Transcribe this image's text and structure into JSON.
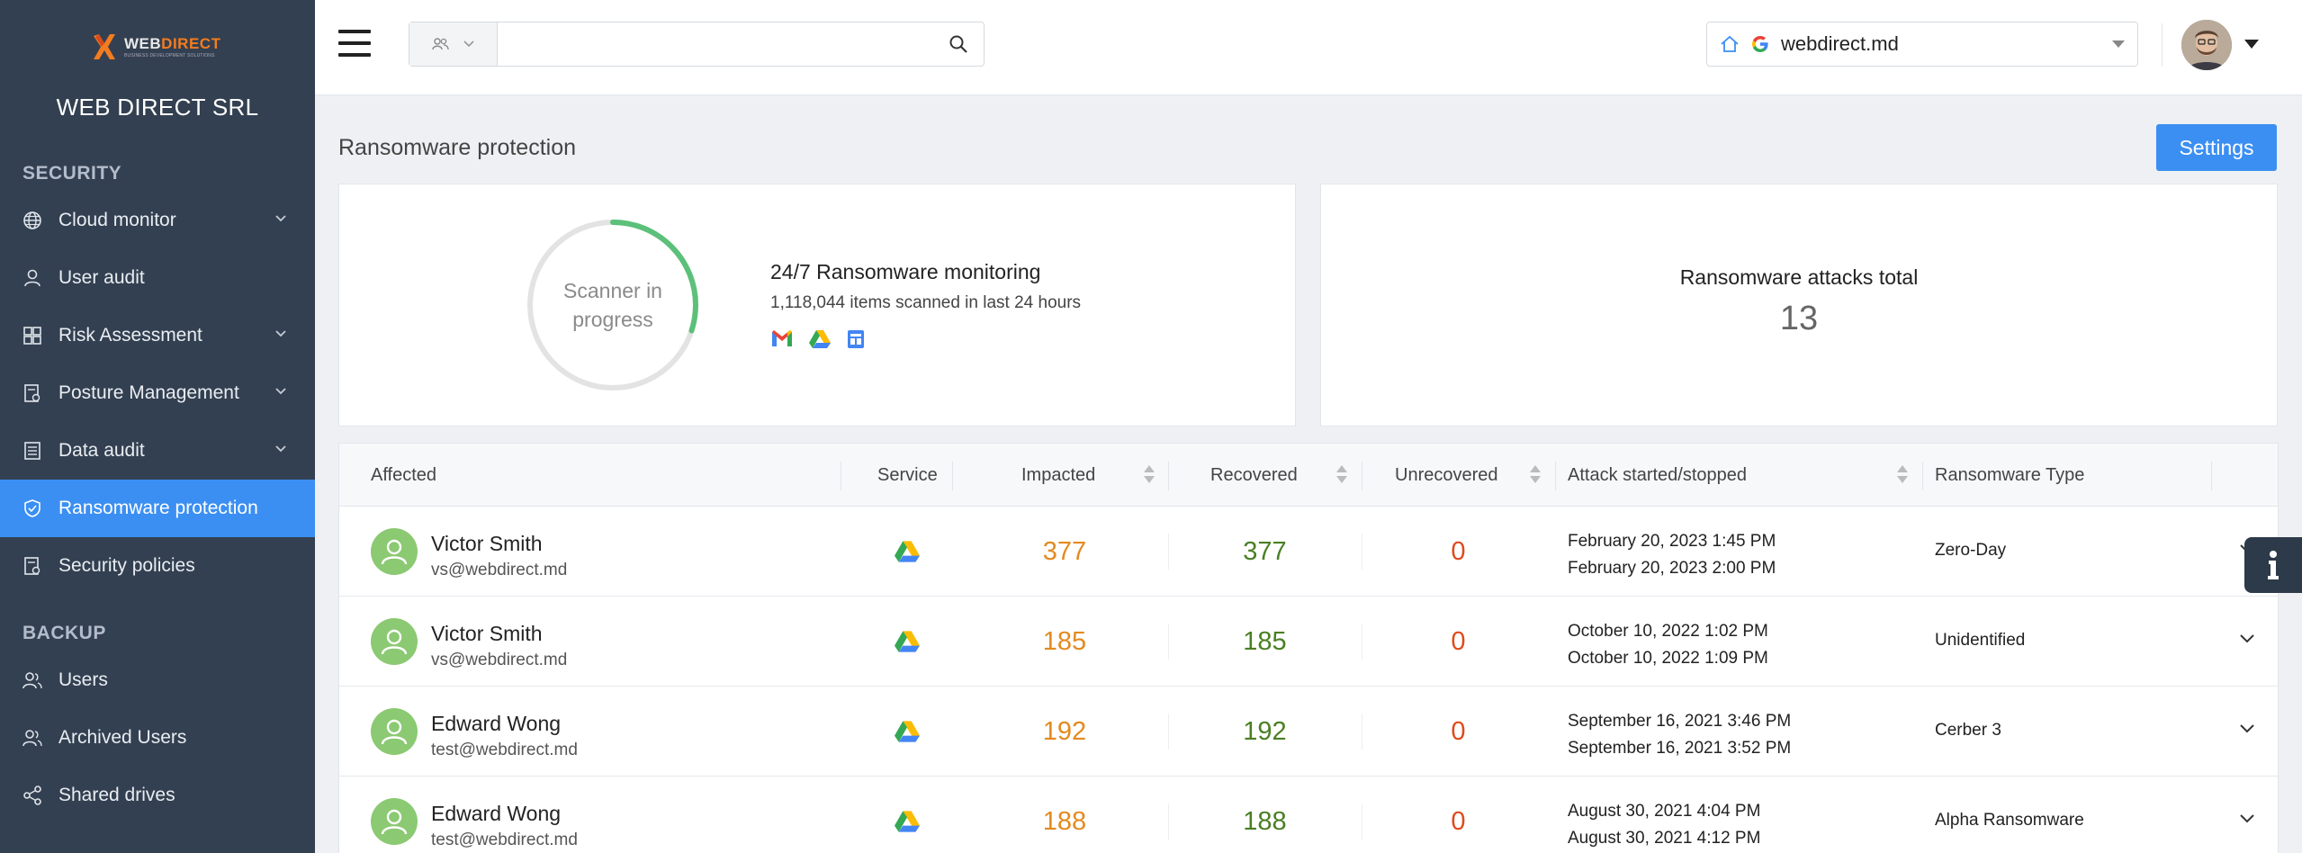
{
  "brand": {
    "logo_word1": "WEB",
    "logo_word2": "DIRECT",
    "logo_tagline": "BUSINESS DEVELOPMENT SOLUTIONS",
    "org_name": "WEB DIRECT SRL"
  },
  "sidebar": {
    "sections": [
      {
        "label": "SECURITY"
      },
      {
        "label": "BACKUP"
      }
    ],
    "items": [
      {
        "label": "Cloud monitor",
        "icon": "globe-icon",
        "has_chevron": true
      },
      {
        "label": "User audit",
        "icon": "user-icon",
        "has_chevron": false
      },
      {
        "label": "Risk Assessment",
        "icon": "grid-icon",
        "has_chevron": true
      },
      {
        "label": "Posture Management",
        "icon": "document-icon",
        "has_chevron": true
      },
      {
        "label": "Data audit",
        "icon": "list-icon",
        "has_chevron": true
      },
      {
        "label": "Ransomware protection",
        "icon": "shield-icon",
        "has_chevron": false,
        "active": true
      },
      {
        "label": "Security policies",
        "icon": "document-icon",
        "has_chevron": false
      },
      {
        "label": "Users",
        "icon": "users-icon",
        "has_chevron": false
      },
      {
        "label": "Archived Users",
        "icon": "users-icon",
        "has_chevron": false
      },
      {
        "label": "Shared drives",
        "icon": "share-icon",
        "has_chevron": false
      }
    ]
  },
  "topbar": {
    "search_placeholder": "",
    "domain": "webdirect.md"
  },
  "page": {
    "title": "Ransomware protection",
    "settings_label": "Settings"
  },
  "monitor": {
    "ring_text_line1": "Scanner in",
    "ring_text_line2": "progress",
    "title": "24/7 Ransomware monitoring",
    "subtitle": "1,118,044 items scanned in last 24 hours",
    "services": [
      "gmail-icon",
      "google-drive-icon",
      "google-sites-icon"
    ],
    "ring_progress": 0.3
  },
  "totals": {
    "title": "Ransomware attacks total",
    "value": "13"
  },
  "table": {
    "columns": [
      "Affected",
      "Service",
      "Impacted",
      "Recovered",
      "Unrecovered",
      "Attack started/stopped",
      "Ransomware Type"
    ],
    "rows": [
      {
        "name": "Victor Smith",
        "email": "vs@webdirect.md",
        "service": "google-drive-icon",
        "impacted": "377",
        "recovered": "377",
        "unrecovered": "0",
        "started": "February 20, 2023 1:45 PM",
        "stopped": "February 20, 2023 2:00 PM",
        "type": "Zero-Day"
      },
      {
        "name": "Victor Smith",
        "email": "vs@webdirect.md",
        "service": "google-drive-icon",
        "impacted": "185",
        "recovered": "185",
        "unrecovered": "0",
        "started": "October 10, 2022 1:02 PM",
        "stopped": "October 10, 2022 1:09 PM",
        "type": "Unidentified"
      },
      {
        "name": "Edward Wong",
        "email": "test@webdirect.md",
        "service": "google-drive-icon",
        "impacted": "192",
        "recovered": "192",
        "unrecovered": "0",
        "started": "September 16, 2021 3:46 PM",
        "stopped": "September 16, 2021 3:52 PM",
        "type": "Cerber 3"
      },
      {
        "name": "Edward Wong",
        "email": "test@webdirect.md",
        "service": "google-drive-icon",
        "impacted": "188",
        "recovered": "188",
        "unrecovered": "0",
        "started": "August 30, 2021 4:04 PM",
        "stopped": "August 30, 2021 4:12 PM",
        "type": "Alpha Ransomware"
      }
    ]
  },
  "colors": {
    "sidebar_bg": "#334051",
    "accent": "#3b8ff2",
    "impacted": "#e38a1f",
    "recovered": "#4a7f23",
    "unrecovered": "#e04a1a",
    "ring_progress": "#5cc07a",
    "user_avatar": "#8bc972"
  }
}
